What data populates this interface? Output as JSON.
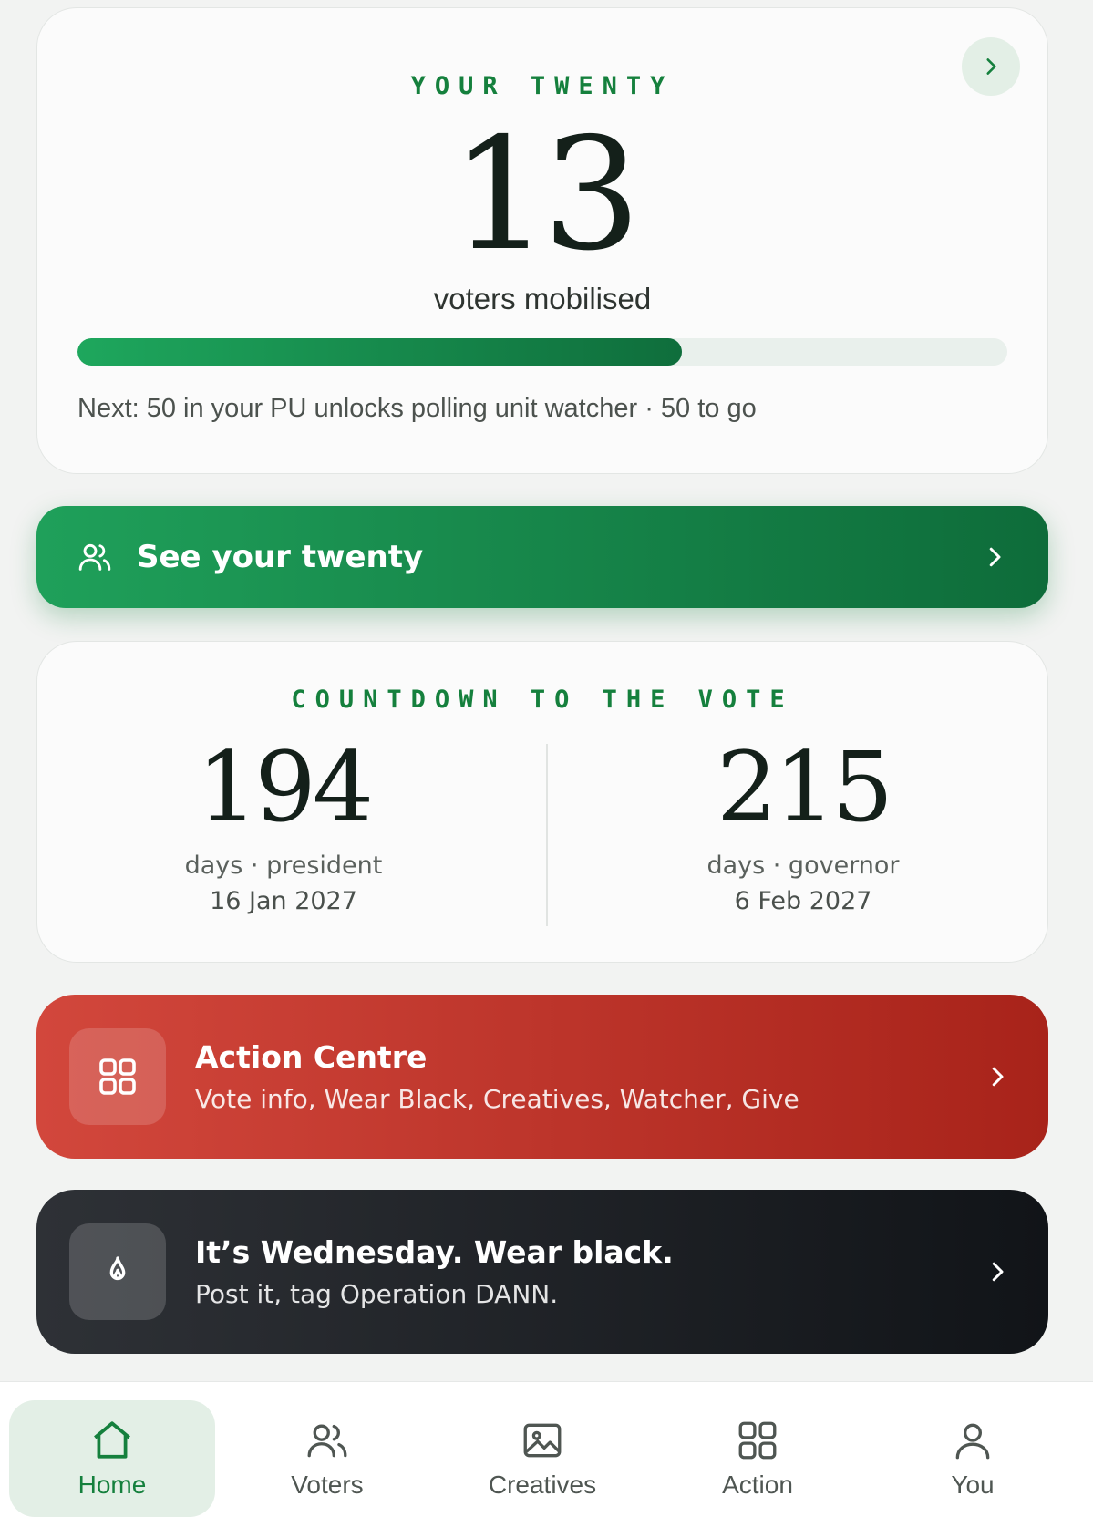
{
  "hero": {
    "eyebrow": "YOUR TWENTY",
    "count": "13",
    "caption": "voters mobilised",
    "progress_percent": 65,
    "next_text": "Next: 50 in your PU unlocks polling unit watcher · 50 to go",
    "chevron_icon": "chevron-right-icon"
  },
  "see_twenty": {
    "label": "See your twenty",
    "icon": "users-icon"
  },
  "countdown": {
    "eyebrow": "COUNTDOWN TO THE VOTE",
    "items": [
      {
        "days": "194",
        "label": "days · president",
        "date": "16 Jan 2027"
      },
      {
        "days": "215",
        "label": "days · governor",
        "date": "6 Feb 2027"
      }
    ]
  },
  "action_centre": {
    "title": "Action Centre",
    "subtitle": "Vote info, Wear Black, Creatives, Watcher, Give",
    "icon": "grid-icon"
  },
  "wear_black": {
    "title": "It’s Wednesday. Wear black.",
    "subtitle": "Post it, tag Operation DANN.",
    "icon": "flame-icon"
  },
  "nav": {
    "items": [
      {
        "label": "Home",
        "icon": "home-icon",
        "active": true
      },
      {
        "label": "Voters",
        "icon": "users-icon",
        "active": false
      },
      {
        "label": "Creatives",
        "icon": "image-icon",
        "active": false
      },
      {
        "label": "Action",
        "icon": "grid-icon",
        "active": false
      },
      {
        "label": "You",
        "icon": "user-icon",
        "active": false
      }
    ]
  },
  "colors": {
    "brand_green": "#15803d",
    "action_red": "#c0392b",
    "dark": "#16191d"
  }
}
